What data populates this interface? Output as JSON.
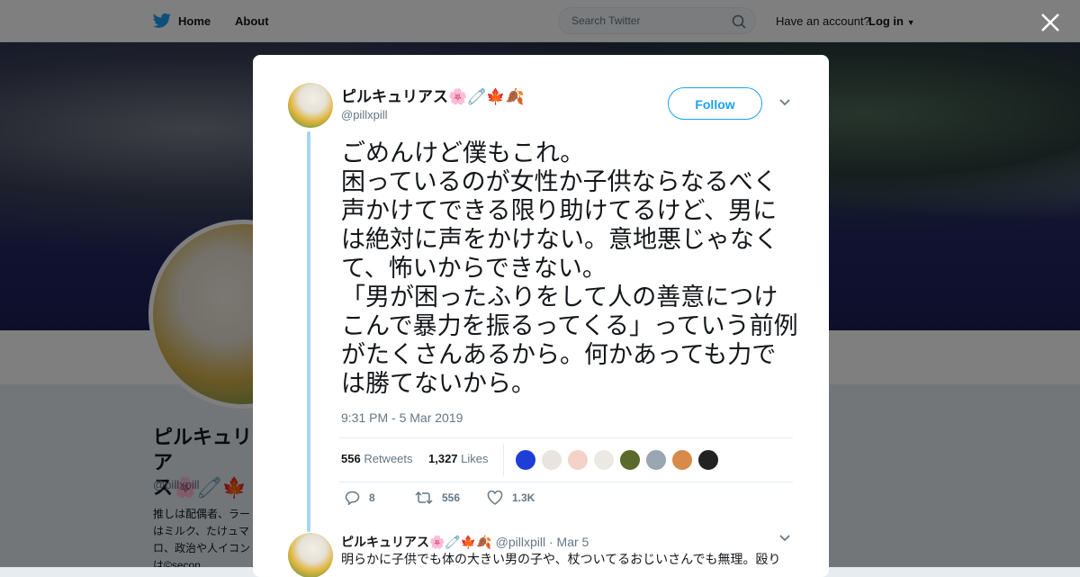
{
  "nav": {
    "home_label": "Home",
    "about_label": "About",
    "search_placeholder": "Search Twitter",
    "have_account": "Have an account?",
    "login_label": "Log in"
  },
  "profile": {
    "name_line1": "ピルキュリア",
    "name_line2": "ス🌸🧷🍁",
    "handle": "@pillxpill",
    "bio": "推しは配偶者、ラーはミルク、たけュマロ、政治や人イコンは©secon"
  },
  "tweet": {
    "author_name": "ピルキュリアス🌸🧷🍁🍂",
    "author_handle": "@pillxpill",
    "follow_label": "Follow",
    "text": "ごめんけど僕もこれ。\n困っているのが女性か子供ならなるべく声かけてできる限り助けてるけど、男には絶対に声をかけない。意地悪じゃなくて、怖いからできない。\n「男が困ったふりをして人の善意につけこんで暴力を振るってくる」っていう前例がたくさんあるから。何かあっても力では勝てないから。",
    "timestamp": "9:31 PM - 5 Mar 2019",
    "retweets_count": "556",
    "retweets_label": "Retweets",
    "likes_count": "1,327",
    "likes_label": "Likes",
    "replies": "8",
    "retweets_action": "556",
    "likes_action": "1.3K",
    "liker_colors": [
      "#1d3fd8",
      "#e8e4de",
      "#f3d2c8",
      "#ece9e4",
      "#5b6a2c",
      "#9aa6b2",
      "#d88a4a",
      "#222222"
    ]
  },
  "reply": {
    "author_name": "ピルキュリアス🌸🧷🍁🍂",
    "author_handle": "@pillxpill",
    "date": "Mar 5",
    "text": "明らかに子供でも体の大きい男の子や、杖ついてるおじいさんでも無理。殴り"
  },
  "colors": {
    "accent": "#1da1f2",
    "thread": "#a8d6f0"
  }
}
